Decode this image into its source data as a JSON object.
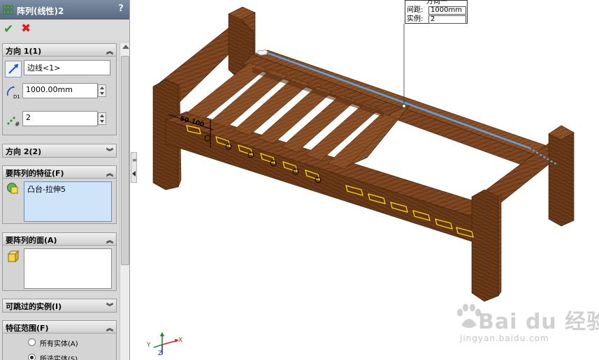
{
  "panel": {
    "title": "阵列(线性)2",
    "help": "?",
    "direction1": {
      "header": "方向 1(1)",
      "edge_field": "边线<1>",
      "spacing_value": "1000.00mm",
      "instances_value": "2"
    },
    "direction2": {
      "header": "方向 2(2)"
    },
    "features": {
      "header": "要阵列的特征(F)",
      "items": [
        "凸台-拉伸5"
      ]
    },
    "faces": {
      "header": "要阵列的面(A)"
    },
    "skip": {
      "header": "可跳过的实例(I)"
    },
    "scope": {
      "header": "特征范围(F)",
      "options": [
        "所有实体(A)",
        "所选实体(S)"
      ],
      "selected_index": 1
    }
  },
  "callout": {
    "title": "方向一",
    "spacing_label": "间距:",
    "spacing_value": "1000mm",
    "instances_label": "实例:",
    "instances_value": "2"
  },
  "dimensions": {
    "d1": "50",
    "d2": "100"
  },
  "triad": {
    "x": "X",
    "y": "Y",
    "z": "Z"
  },
  "watermark": {
    "brand": "Bai du 经验",
    "url": "jingyan.baidu.com"
  },
  "colors": {
    "wood": "#7a4320",
    "wood_dark": "#5a2e12",
    "selection_blue": "#5aa6ea",
    "preview_yellow": "#ffe000"
  }
}
